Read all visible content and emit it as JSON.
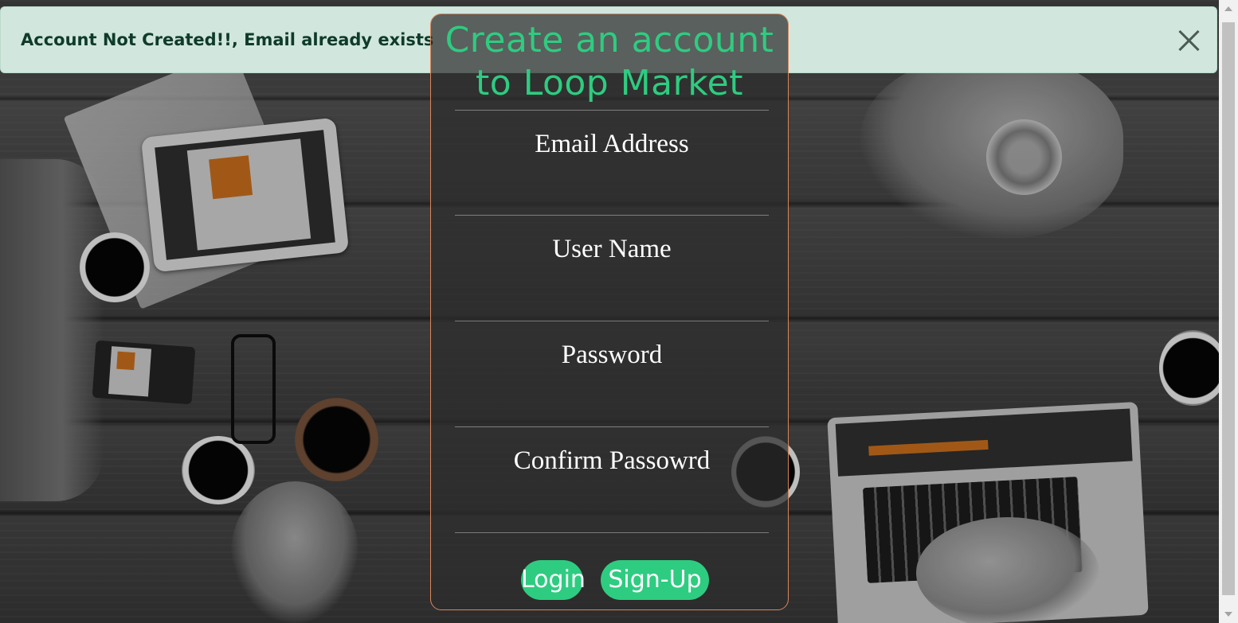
{
  "alert": {
    "message": "Account Not Created!!, Email already exists",
    "close_icon": "close-icon",
    "color": "#d1e7dd"
  },
  "form": {
    "title": "Create an account to Loop Market",
    "title_color": "#2ecc80",
    "fields": [
      {
        "label": "Email Address"
      },
      {
        "label": "User Name"
      },
      {
        "label": "Password"
      },
      {
        "label": "Confirm Passowrd"
      }
    ],
    "buttons": {
      "login": "Login",
      "signup": "Sign-Up"
    }
  }
}
